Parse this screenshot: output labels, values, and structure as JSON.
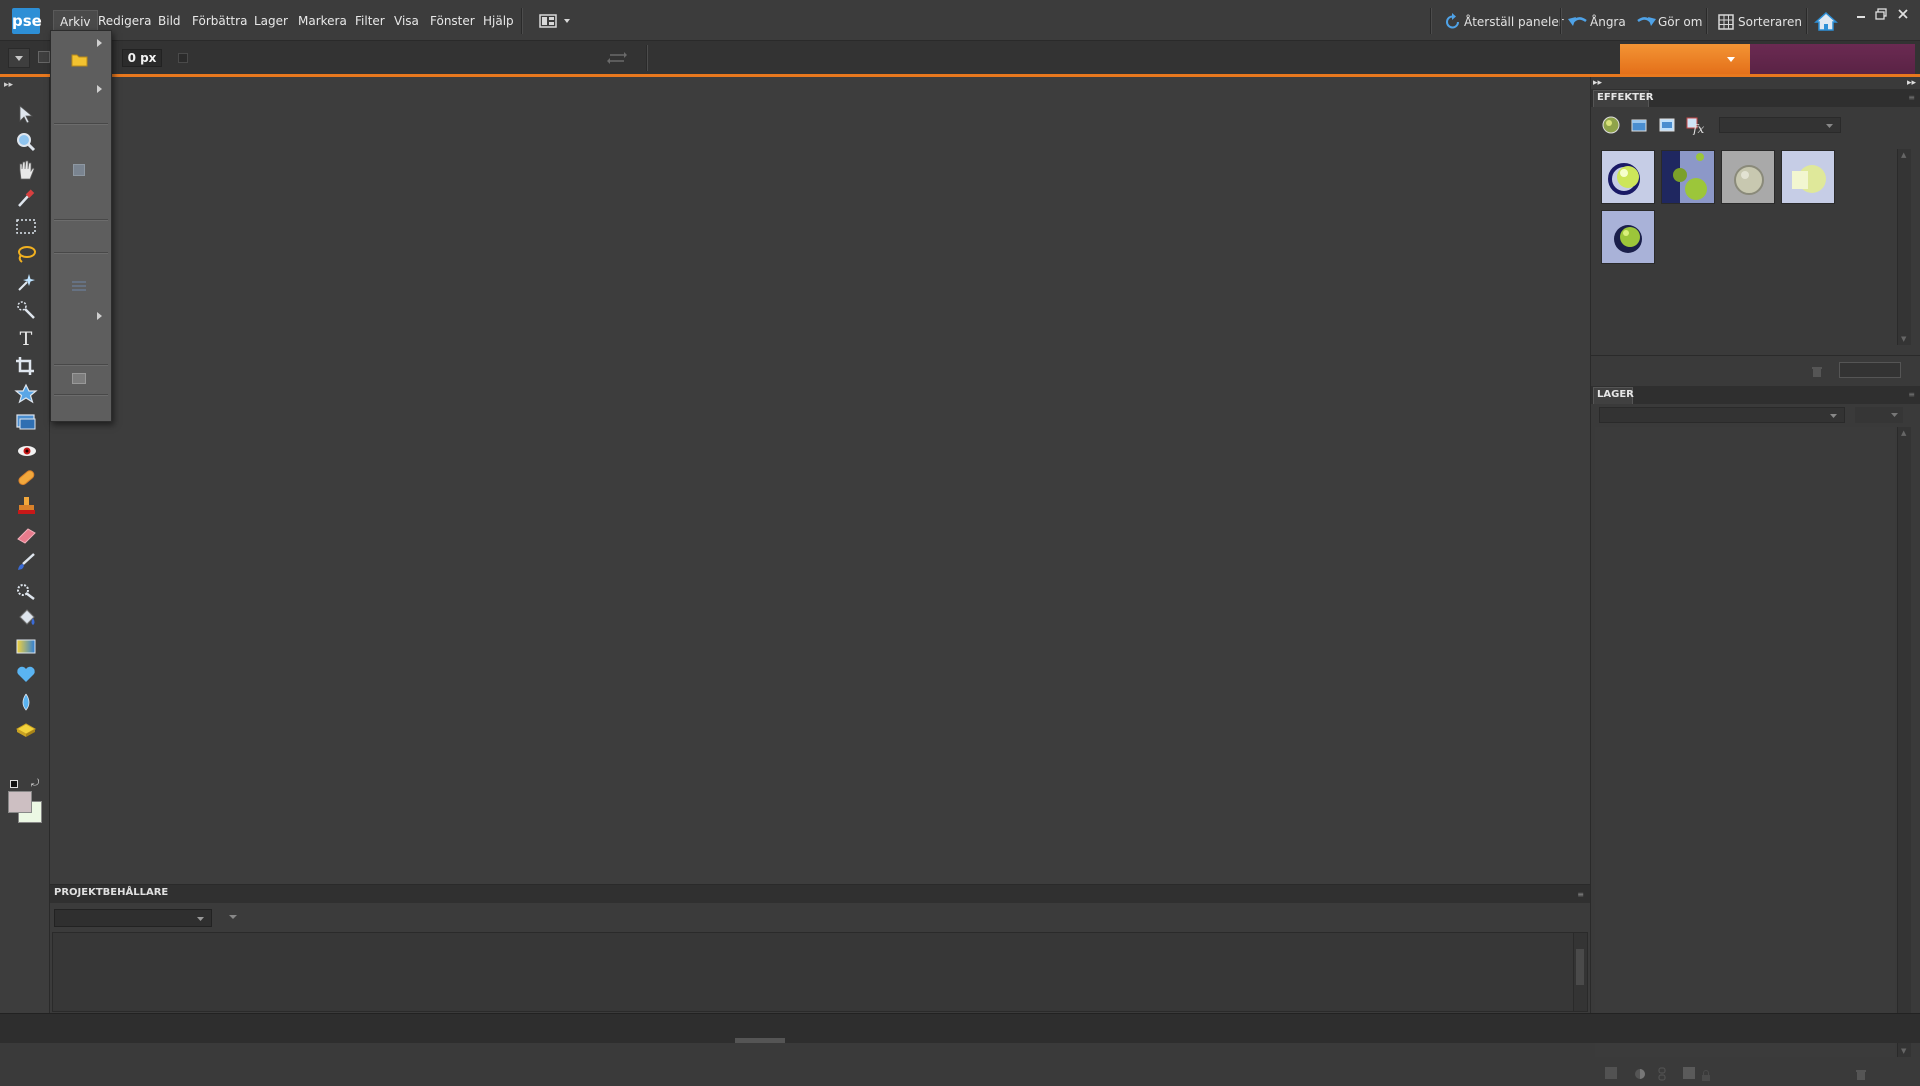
{
  "app": {
    "logo_text": "pse"
  },
  "menubar": {
    "items": [
      {
        "label": "Arkiv",
        "active": true
      },
      {
        "label": "Redigera"
      },
      {
        "label": "Bild"
      },
      {
        "label": "Förbättra"
      },
      {
        "label": "Lager"
      },
      {
        "label": "Markera"
      },
      {
        "label": "Filter"
      },
      {
        "label": "Visa"
      },
      {
        "label": "Fönster"
      },
      {
        "label": "Hjälp"
      }
    ],
    "right": {
      "reset_panels": "Återställ paneler",
      "undo": "Ångra",
      "redo": "Gör om",
      "organizer": "Sorteraren"
    }
  },
  "options_bar": {
    "size_value": "0 px"
  },
  "panels": {
    "effects": {
      "title": "EFFEKTER"
    },
    "layers": {
      "title": "LAGER"
    }
  },
  "project_bin": {
    "title": "PROJEKTBEHÅLLARE"
  },
  "colors": {
    "accent_orange": "#e8781e",
    "accent_purple": "#6b2a52",
    "logo_blue": "#2d8fd6"
  }
}
